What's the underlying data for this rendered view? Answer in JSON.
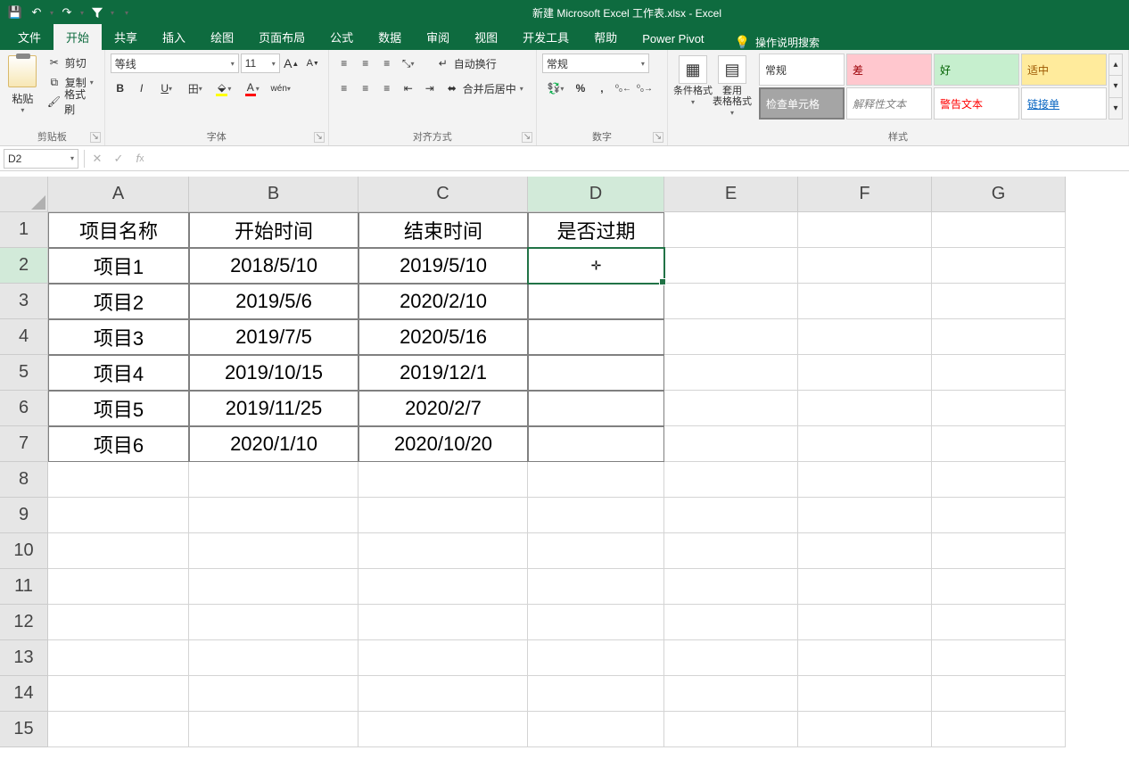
{
  "title": "新建 Microsoft Excel 工作表.xlsx  -  Excel",
  "qat": {
    "save": "💾",
    "undo": "↶",
    "redo": "↷",
    "filter": "▼"
  },
  "tabs": [
    "文件",
    "开始",
    "共享",
    "插入",
    "绘图",
    "页面布局",
    "公式",
    "数据",
    "审阅",
    "视图",
    "开发工具",
    "帮助",
    "Power Pivot"
  ],
  "active_tab_index": 1,
  "search_hint": "操作说明搜索",
  "ribbon": {
    "clipboard": {
      "paste": "粘贴",
      "cut": "剪切",
      "copy": "复制",
      "painter": "格式刷",
      "label": "剪贴板"
    },
    "font": {
      "name": "等线",
      "size": "11",
      "label": "字体"
    },
    "align": {
      "wrap": "自动换行",
      "merge": "合并后居中",
      "label": "对齐方式"
    },
    "number": {
      "format": "常规",
      "label": "数字"
    },
    "styles": {
      "cond": "条件格式",
      "table": "套用\n表格格式",
      "cells": [
        "常规",
        "差",
        "好",
        "适中",
        "检查单元格",
        "解释性文本",
        "警告文本",
        "链接单"
      ],
      "label": "样式"
    }
  },
  "name_box": "D2",
  "formula": "",
  "columns": [
    "A",
    "B",
    "C",
    "D",
    "E",
    "F",
    "G"
  ],
  "row_headers": [
    "1",
    "2",
    "3",
    "4",
    "5",
    "6",
    "7",
    "8",
    "9",
    "10",
    "11",
    "12",
    "13",
    "14",
    "15"
  ],
  "sheet": {
    "header": [
      "项目名称",
      "开始时间",
      "结束时间",
      "是否过期"
    ],
    "rows": [
      [
        "项目1",
        "2018/5/10",
        "2019/5/10",
        ""
      ],
      [
        "项目2",
        "2019/5/6",
        "2020/2/10",
        ""
      ],
      [
        "项目3",
        "2019/7/5",
        "2020/5/16",
        ""
      ],
      [
        "项目4",
        "2019/10/15",
        "2019/12/1",
        ""
      ],
      [
        "项目5",
        "2019/11/25",
        "2020/2/7",
        ""
      ],
      [
        "项目6",
        "2020/1/10",
        "2020/10/20",
        ""
      ]
    ]
  },
  "selected_cell": {
    "col": "D",
    "row": 2
  }
}
